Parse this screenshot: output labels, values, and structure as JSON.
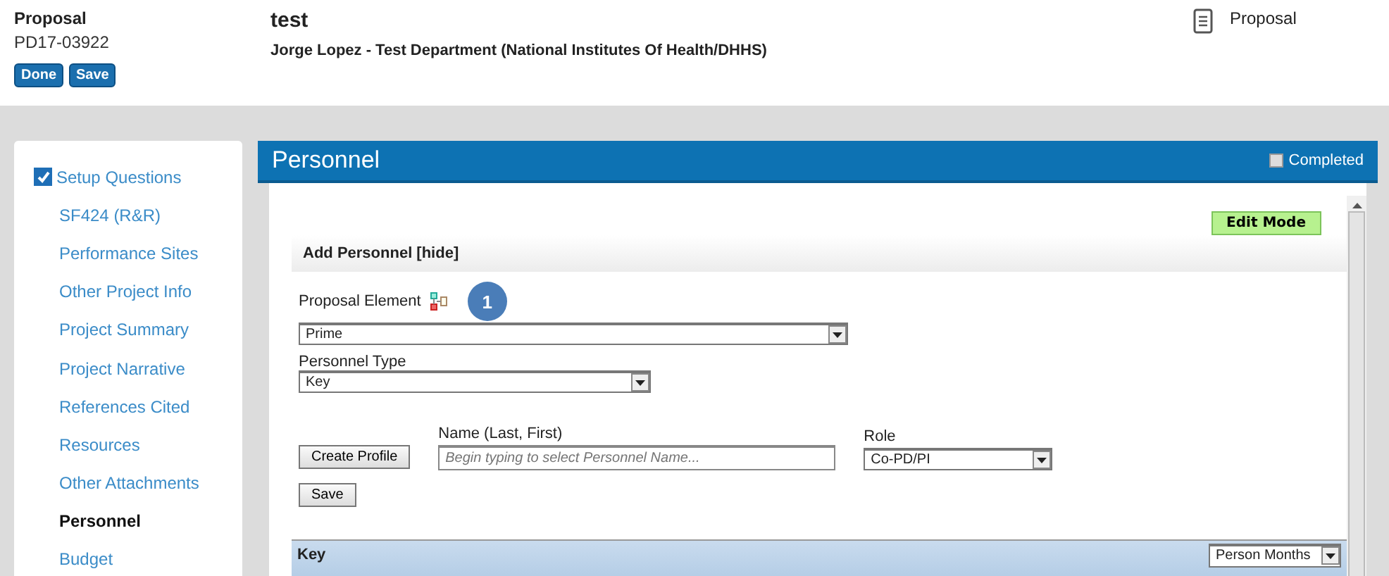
{
  "header": {
    "type_label": "Proposal",
    "number": "PD17-03922",
    "buttons": [
      "Done",
      "Save"
    ],
    "title": "test",
    "subtitle": "Jorge Lopez - Test Department (National Institutes Of Health/DHHS)",
    "doc_link": "Proposal"
  },
  "sidebar": {
    "items": [
      {
        "label": "Setup Questions",
        "kind": "checkbox",
        "checked": true,
        "selected": false
      },
      {
        "label": "SF424 (R&R)",
        "kind": "link",
        "selected": false
      },
      {
        "label": "Performance Sites",
        "kind": "link",
        "selected": false
      },
      {
        "label": "Other Project Info",
        "kind": "link",
        "selected": false
      },
      {
        "label": "Project Summary",
        "kind": "link",
        "selected": false
      },
      {
        "label": "Project Narrative",
        "kind": "link",
        "selected": false
      },
      {
        "label": "References Cited",
        "kind": "link",
        "selected": false
      },
      {
        "label": "Resources",
        "kind": "link",
        "selected": false
      },
      {
        "label": "Other Attachments",
        "kind": "link",
        "selected": false
      },
      {
        "label": "Personnel",
        "kind": "link",
        "selected": true
      },
      {
        "label": "Budget",
        "kind": "link",
        "selected": false
      }
    ]
  },
  "panel": {
    "title": "Personnel",
    "completed": {
      "label": "Completed",
      "checked": false
    },
    "mode_button": "Edit Mode",
    "section": {
      "title": "Add Personnel [hide]",
      "element_label": "Proposal Element",
      "step_badge": "1",
      "element_value": "Prime",
      "type_label": "Personnel Type",
      "type_value": "Key",
      "create_button": "Create Profile",
      "name_label": "Name (Last, First)",
      "name_placeholder": "Begin typing to select Personnel Name...",
      "role_label": "Role",
      "role_value": "Co-PD/PI",
      "save_button": "Save"
    },
    "table": {
      "title": "Key",
      "units": "Person Months"
    }
  }
}
